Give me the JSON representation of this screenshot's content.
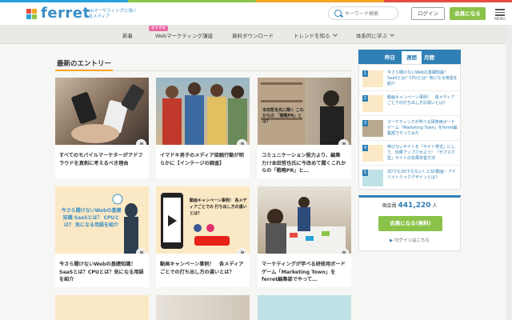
{
  "header": {
    "logo": "ferret",
    "tagline": "Webマーケティングに強くなるメディア",
    "search_placeholder": "キーワード検索",
    "login_label": "ログイン",
    "join_label": "会員になる",
    "menu_label": "MENU"
  },
  "nav": {
    "items": [
      "新着",
      "Webマーケティング講座",
      "資料ダウンロード",
      "トレンドを知る",
      "体系的に学ぶ"
    ],
    "badge": "おすすめ"
  },
  "section_title": "最新のエントリー",
  "articles": [
    {
      "title": "すべてのモバイルマーケターがアドフラウドを真剣に考えるべき理由",
      "thumb_text": ""
    },
    {
      "title": "イマドキ男子のメディア接触行動が明らかに【インテージの調査】",
      "thumb_text": ""
    },
    {
      "title": "コミュニケーション能力より、編集力!?本田哲也氏に今改めて聞くこれからの「戦略PR」と…",
      "thumb_text": "本田哲也氏に聞く これからの 「戦略PR」とは？"
    },
    {
      "title": "今さら聞けないWebの基礎知識！SaaSとは？CPUとは？気になる用語を紹介",
      "thumb_text": "今さら聞けないWebの基礎知識 SaaSとは？ CPUとは？ 気になる用語を紹介"
    },
    {
      "title": "動画キャンペーン事例！　各メディアごとでの打ち出し方の違いとは？",
      "thumb_text": "動画キャンペーン事例！ 各メディアごとでの 打ち出し方の違いとは？"
    },
    {
      "title": "マーケティングが学べる研修用ボードゲーム「Marketing Town」をferret編集部でやって…",
      "thumb_text": ""
    }
  ],
  "sidebar": {
    "tabs": [
      "昨日",
      "週間",
      "月間"
    ],
    "active_tab": "週間",
    "ranking": [
      "今さら聞けないWebの基礎知識！SaaSとは？CPUとは？気になる用語を紹介",
      "動画キャンペーン事例！　各メディアごとでの打ち出し方の違いとは？",
      "マーケティングが学べる研修用ボードゲーム「Marketing Town」をferret編集部でやってみた",
      "伸びないサイトを「サイト男式」にして、効果アップさせよう！「サブスク型」サイトの効果改善方法",
      "2Dでも3Dでもない！2.5D動画・アイソメトリックデザインとは？"
    ],
    "ranking_nums": [
      "1",
      "2",
      "3",
      "4",
      "5"
    ],
    "members_label": "現会員",
    "members_count": "441,220",
    "members_unit": "人",
    "join_free_label": "会員になる(無料)",
    "login_link": "ログインはこちら"
  },
  "colors": {
    "brand": "#3a8fc8",
    "accent": "#f5a623",
    "join": "#8bc34a",
    "rank": "#2f7fb5"
  }
}
